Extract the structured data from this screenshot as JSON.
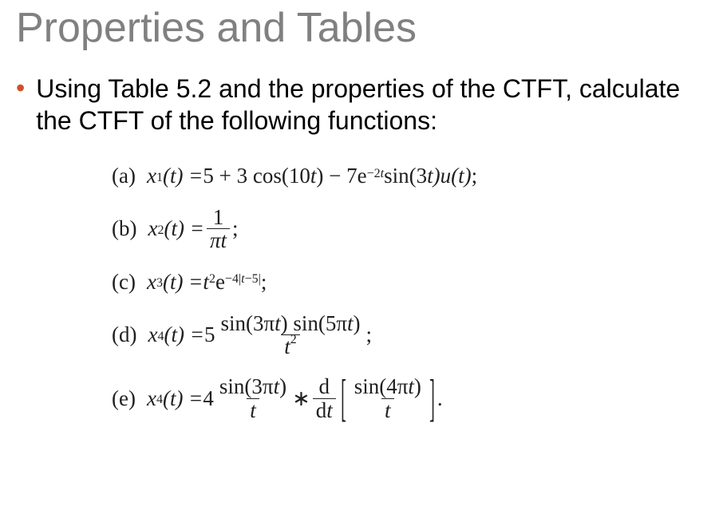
{
  "title": "Properties and Tables",
  "bullet_char": "•",
  "prompt": "Using Table 5.2 and the properties of the CTFT, calculate the CTFT of the following functions:",
  "equations": {
    "a": {
      "label": "(a)",
      "lhs_var": "x",
      "lhs_sub": "1",
      "lhs_arg": "(t) = ",
      "rhs_prefix": "5 + 3 cos(10",
      "rhs_t1": "t",
      "rhs_mid": ") − 7e",
      "exp1": "−2",
      "exp1_t": "t",
      "rhs_sin": " sin(3",
      "rhs_t2": "t",
      "rhs_u": ")u",
      "rhs_t3": "(t)",
      "rhs_end": ";"
    },
    "b": {
      "label": "(b)",
      "lhs_var": "x",
      "lhs_sub": "2",
      "lhs_arg": "(t) = ",
      "num": "1",
      "den_pi": "π",
      "den_t": "t",
      "end": ";"
    },
    "c": {
      "label": "(c)",
      "lhs_var": "x",
      "lhs_sub": "3",
      "lhs_arg": "(t) = ",
      "t": "t",
      "sq": "2",
      "e": "e",
      "exp_a": "−4|",
      "exp_t": "t",
      "exp_b": "−5|",
      "end": ";"
    },
    "d": {
      "label": "(d)",
      "lhs_var": "x",
      "lhs_sub": "4",
      "lhs_arg": "(t) = ",
      "coef": "5",
      "num_a": "sin(3π",
      "num_t1": "t",
      "num_b": ") sin(5π",
      "num_t2": "t",
      "num_c": ")",
      "den_t": "t",
      "den_sq": "2",
      "end": ";"
    },
    "e": {
      "label": "(e)",
      "lhs_var": "x",
      "lhs_sub": "4",
      "lhs_arg": "(t) = ",
      "coef": "4",
      "f1_num_a": "sin(3π",
      "f1_num_t": "t",
      "f1_num_b": ")",
      "f1_den": "t",
      "conv": " ∗ ",
      "d_num": "d",
      "d_den_a": "d",
      "d_den_t": "t",
      "lbr": "[",
      "f2_num_a": "sin(4π",
      "f2_num_t": "t",
      "f2_num_b": ")",
      "f2_den": "t",
      "rbr": "]",
      "end": "."
    }
  }
}
